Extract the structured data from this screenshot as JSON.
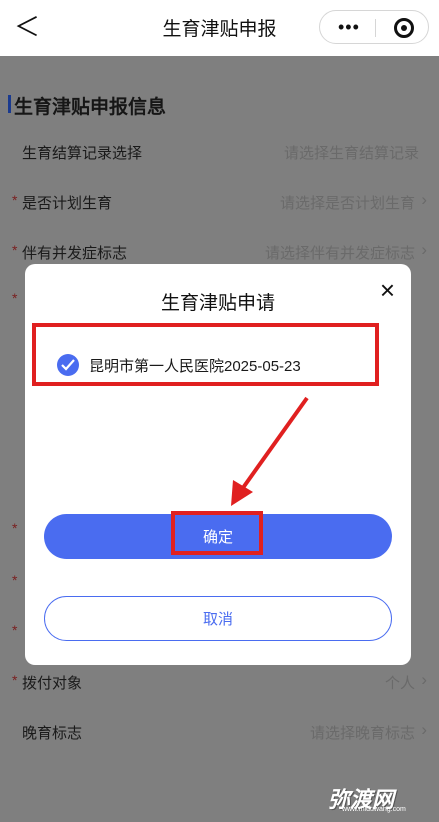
{
  "nav": {
    "back_glyph": "＜",
    "title": "生育津贴申报",
    "more_glyph": "•••"
  },
  "section": {
    "title": "生育津贴申报信息"
  },
  "form_rows": [
    {
      "label": "生育结算记录选择",
      "required": false,
      "value": "请选择生育结算记录",
      "chevron": false
    },
    {
      "label": "是否计划生育",
      "required": true,
      "value": "请选择是否计划生育",
      "chevron": true
    },
    {
      "label": "伴有并发症标志",
      "required": true,
      "value": "请选择伴有并发症标志",
      "chevron": true
    },
    {
      "label": "拨付对象",
      "required": true,
      "value": "个人",
      "chevron": true
    },
    {
      "label": "晚育标志",
      "required": false,
      "value": "请选择晚育标志",
      "chevron": true
    }
  ],
  "modal": {
    "title": "生育津贴申请",
    "close_glyph": "×",
    "option_text": "昆明市第一人民医院2025-05-23",
    "option_checked": true,
    "confirm_label": "确定",
    "cancel_label": "取消"
  },
  "watermark": {
    "text": "弥渡网",
    "sub": "www.miduwang.com"
  },
  "colors": {
    "accent": "#4a6cf0",
    "highlight": "#e02020",
    "overlay": "#7f7f7f"
  }
}
